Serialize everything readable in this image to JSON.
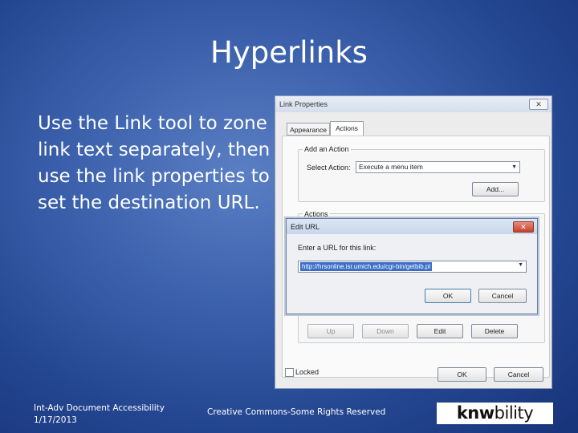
{
  "slide": {
    "title": "Hyperlinks",
    "body": "Use the Link tool to zone link text separately, then use the link properties to set the destination URL.",
    "footer_line1": "Int-Adv Document Accessibility",
    "footer_line2": "1/17/2013",
    "footer_center": "Creative Commons-Some Rights Reserved",
    "logo_part1": "kn",
    "logo_part2": "w",
    "logo_part3": "bility"
  },
  "link_properties": {
    "title": "Link Properties",
    "tabs": [
      "Appearance",
      "Actions"
    ],
    "active_tab": "Actions",
    "add_action_label": "Add an Action",
    "select_action_label": "Select Action:",
    "select_action_value": "Execute a menu item",
    "add_button": "Add...",
    "actions_label": "Actions",
    "up_button": "Up",
    "down_button": "Down",
    "edit_button": "Edit",
    "delete_button": "Delete",
    "locked_label": "Locked",
    "ok_button": "OK",
    "cancel_button": "Cancel"
  },
  "edit_url": {
    "title": "Edit URL",
    "prompt": "Enter a URL for this link:",
    "url_value": "http://hrsonline.isr.umich.edu/cgi-bin/getbib.pl",
    "ok_button": "OK",
    "cancel_button": "Cancel"
  },
  "icons": {
    "close": "close-icon",
    "dropdown": "chevron-down-icon"
  },
  "colors": {
    "background": "#3d62ad",
    "selection": "#3b6fc7",
    "close_red": "#c8412b"
  }
}
